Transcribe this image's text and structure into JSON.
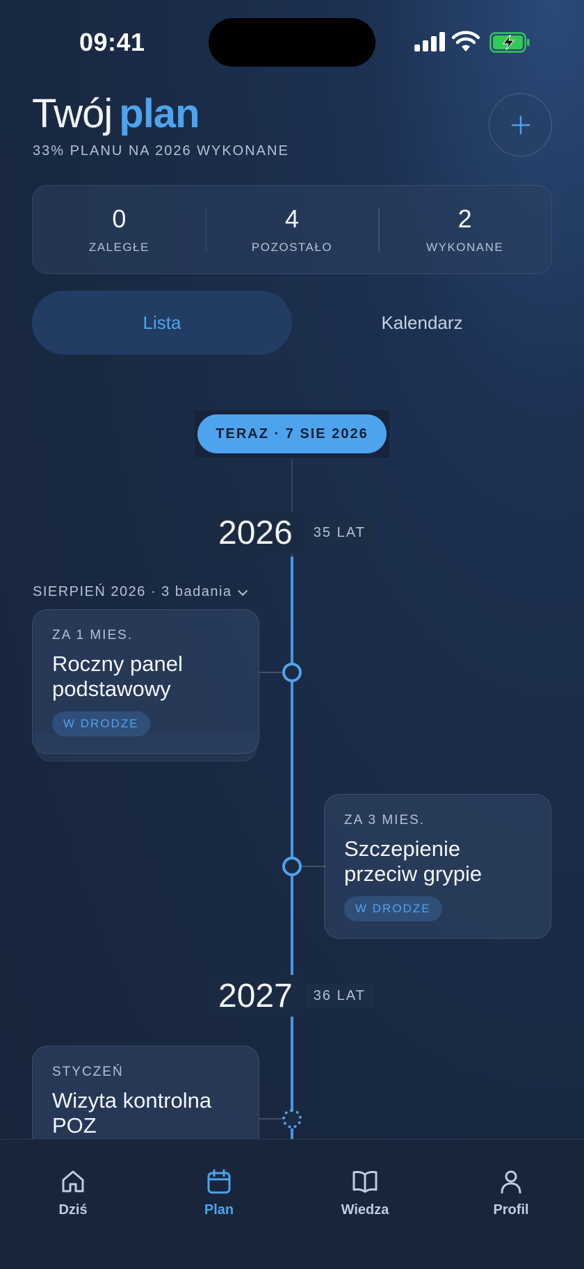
{
  "status_bar": {
    "time": "09:41"
  },
  "header": {
    "title_plain": "Twój",
    "title_accent": "plan",
    "subtitle": "33% PLANU NA 2026 WYKONANE",
    "add_icon": "plus-icon"
  },
  "stats": [
    {
      "value": "0",
      "label": "ZALEGŁE"
    },
    {
      "value": "4",
      "label": "POZOSTAŁO"
    },
    {
      "value": "2",
      "label": "WYKONANE"
    }
  ],
  "view_switch": {
    "options": [
      "Lista",
      "Kalendarz"
    ],
    "selected": "Lista"
  },
  "timeline": {
    "now_label": "TERAZ · 7 SIE 2026",
    "years": [
      {
        "year": "2026",
        "age": "35 LAT"
      },
      {
        "year": "2027",
        "age": "36 LAT"
      }
    ],
    "month_group": "SIERPIEŃ 2026 · 3 badania",
    "items": [
      {
        "when": "ZA 1 MIES.",
        "title": "Roczny panel podstawowy",
        "status": "W DRODZE"
      },
      {
        "when": "ZA 3 MIES.",
        "title": "Szczepienie przeciw grypie",
        "status": "W DRODZE"
      },
      {
        "when": "STYCZEŃ",
        "title": "Wizyta kontrolna POZ",
        "status": ""
      }
    ]
  },
  "tabbar": {
    "items": [
      {
        "label": "Dziś",
        "icon": "home-icon"
      },
      {
        "label": "Plan",
        "icon": "calendar-icon"
      },
      {
        "label": "Wiedza",
        "icon": "book-icon"
      },
      {
        "label": "Profil",
        "icon": "user-icon"
      }
    ],
    "active": "Plan"
  },
  "colors": {
    "accent": "#4ea3ee",
    "background": "#1a2a44",
    "battery": "#34c759"
  }
}
